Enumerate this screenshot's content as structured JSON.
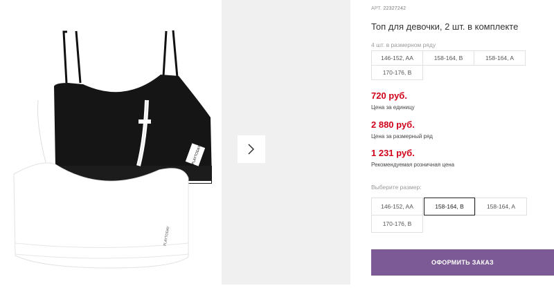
{
  "product": {
    "art_label": "АРТ.",
    "art_number": "22327242",
    "title": "Топ для девочки, 2 шт. в комплекте",
    "brand_tag": "PLAYTODAY"
  },
  "size_row": {
    "label": "4 шт. в размерном ряду",
    "sizes": [
      "146-152, AA",
      "158-164, B",
      "158-164, A",
      "170-176, B"
    ]
  },
  "prices": [
    {
      "value": "720 руб.",
      "caption": "Цена за единицу"
    },
    {
      "value": "2 880 руб.",
      "caption": "Цена за размерный ряд"
    },
    {
      "value": "1 231 руб.",
      "caption": "Рекомендуемая розничная цена"
    }
  ],
  "size_select": {
    "label": "Выберите размер:",
    "sizes": [
      "146-152, AA",
      "158-164, B",
      "158-164, A",
      "170-176, B"
    ],
    "selected": "158-164, B"
  },
  "order_button": "ОФОРМИТЬ ЗАКАЗ",
  "colors": {
    "price": "#d0021b",
    "button": "#7b5a95",
    "selected_border": "#222222"
  },
  "icons": {
    "next": "chevron-right-icon"
  }
}
